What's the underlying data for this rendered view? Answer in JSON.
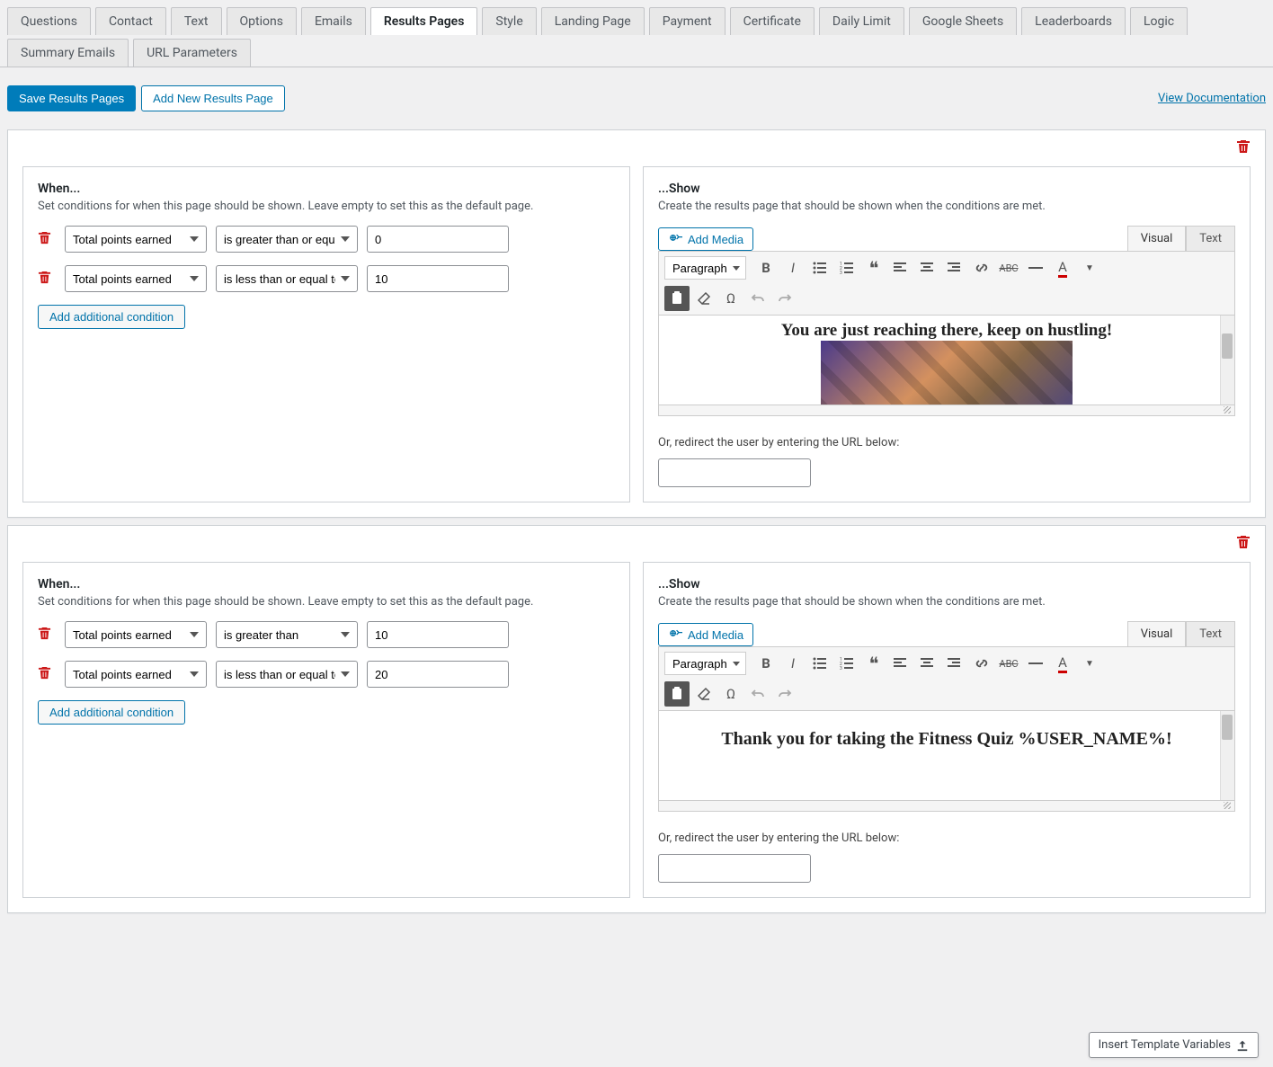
{
  "tabs_row1": [
    "Questions",
    "Contact",
    "Text",
    "Options",
    "Emails",
    "Results Pages",
    "Style",
    "Landing Page",
    "Payment",
    "Certificate",
    "Daily Limit",
    "Google Sheets",
    "Leaderboards",
    "Logic"
  ],
  "tabs_row2": [
    "Summary Emails",
    "URL Parameters"
  ],
  "active_tab": "Results Pages",
  "buttons": {
    "save": "Save Results Pages",
    "add_new": "Add New Results Page",
    "doc_link": "View Documentation"
  },
  "when": {
    "title": "When...",
    "desc": "Set conditions for when this page should be shown. Leave empty to set this as the default page.",
    "add": "Add additional condition"
  },
  "show": {
    "title": "...Show",
    "desc": "Create the results page that should be shown when the conditions are met.",
    "add_media": "Add Media",
    "visual_tab": "Visual",
    "text_tab": "Text",
    "format": "Paragraph",
    "redirect_label": "Or, redirect the user by entering the URL below:"
  },
  "criteria_label": "Total points earned",
  "insert_vars": "Insert Template Variables",
  "pages": [
    {
      "conditions": [
        {
          "criteria": "Total points earned",
          "op": "is greater than or equal to",
          "val": "0"
        },
        {
          "criteria": "Total points earned",
          "op": "is less than or equal to",
          "val": "10"
        }
      ],
      "content_text": "You are just reaching there, keep on hustling!",
      "has_image": true
    },
    {
      "conditions": [
        {
          "criteria": "Total points earned",
          "op": "is greater than",
          "val": "10"
        },
        {
          "criteria": "Total points earned",
          "op": "is less than or equal to",
          "val": "20"
        }
      ],
      "content_text": "Thank you for taking the Fitness Quiz %USER_NAME%!"
    }
  ]
}
